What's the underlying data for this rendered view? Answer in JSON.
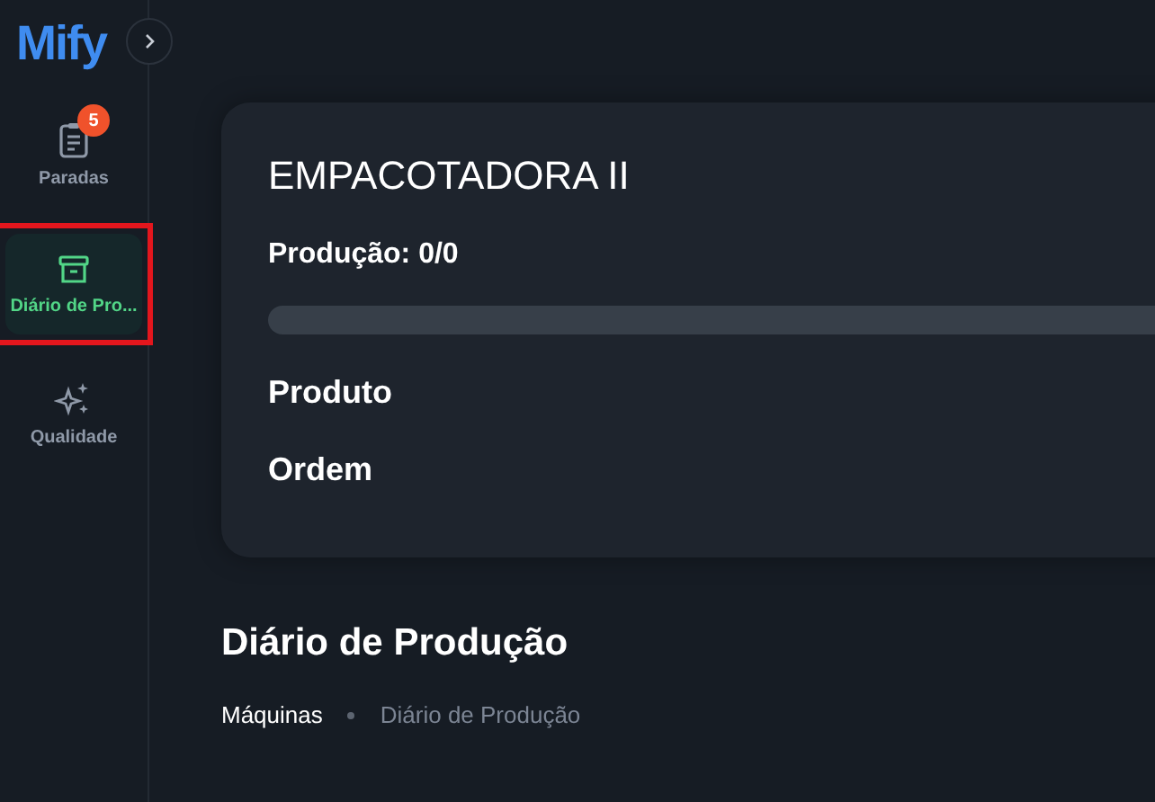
{
  "logo": "Mify",
  "nav_items": [
    {
      "label": "Paradas",
      "kind": "clipboard",
      "badge": "5",
      "selected": false,
      "highlighted": false
    },
    {
      "label": "Diário de Pro...",
      "kind": "archive",
      "selected": true,
      "highlighted": true
    },
    {
      "label": "Qualidade",
      "kind": "sparkles",
      "selected": false,
      "highlighted": false
    }
  ],
  "machine_card": {
    "title": "EMPACOTADORA II",
    "production": "Produção: 0/0",
    "fields": [
      "Produto",
      "Ordem"
    ]
  },
  "page_title": "Diário de Produção",
  "breadcrumb": [
    {
      "label": "Máquinas",
      "current": false
    },
    {
      "label": "Diário de Produção",
      "current": true
    }
  ]
}
